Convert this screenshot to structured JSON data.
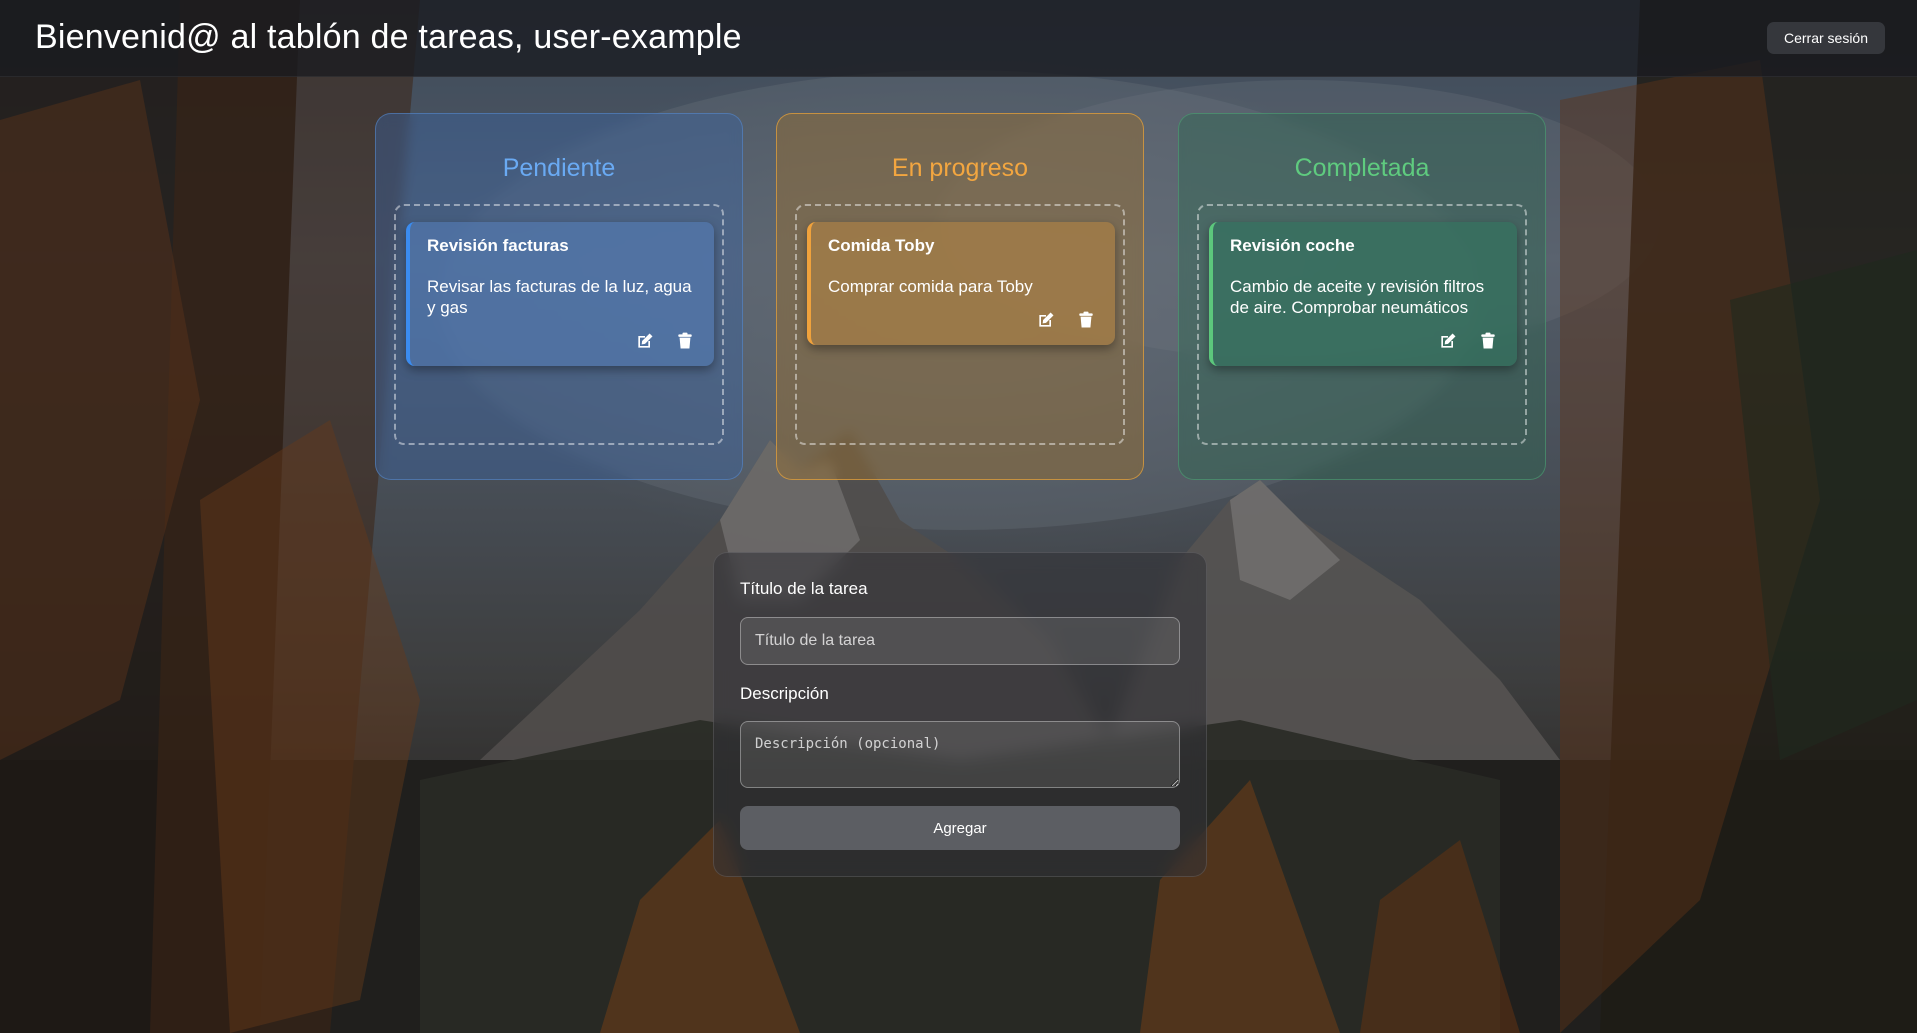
{
  "header": {
    "title": "Bienvenid@ al tablón de tareas, user-example",
    "logout_label": "Cerrar sesión"
  },
  "columns": [
    {
      "title": "Pendiente",
      "accent": "#3b8cf0",
      "tasks": [
        {
          "title": "Revisión facturas",
          "description": "Revisar las facturas de la luz, agua y gas"
        }
      ]
    },
    {
      "title": "En progreso",
      "accent": "#f0a23c",
      "tasks": [
        {
          "title": "Comida Toby",
          "description": "Comprar comida para Toby"
        }
      ]
    },
    {
      "title": "Completada",
      "accent": "#5cc77c",
      "tasks": [
        {
          "title": "Revisión coche",
          "description": "Cambio de aceite y revisión filtros de aire. Comprobar neumáticos"
        }
      ]
    }
  ],
  "form": {
    "title_label": "Título de la tarea",
    "title_placeholder": "Título de la tarea",
    "description_label": "Descripción",
    "description_placeholder": "Descripción (opcional)",
    "submit_label": "Agregar"
  },
  "icons": {
    "edit": "edit-icon",
    "delete": "trash-icon"
  }
}
